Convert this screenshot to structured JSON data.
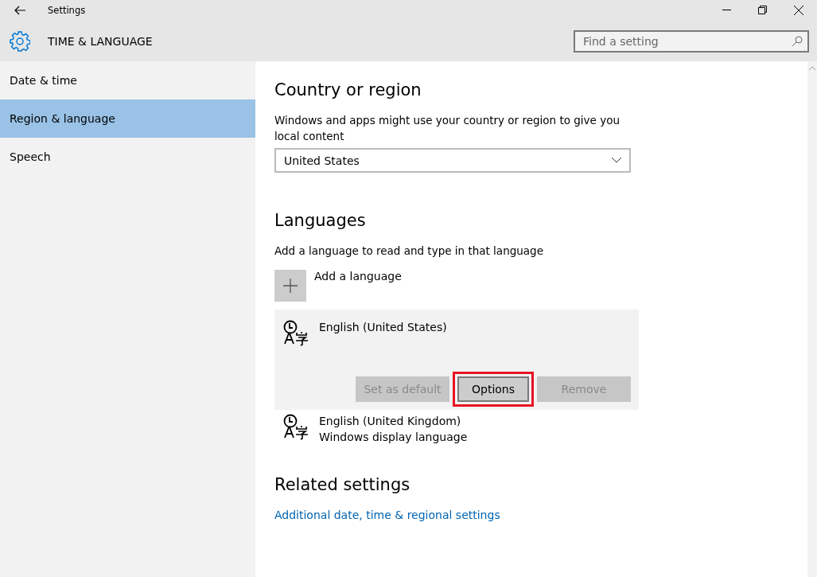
{
  "window": {
    "title": "Settings"
  },
  "header": {
    "title": "TIME & LANGUAGE",
    "search": {
      "placeholder": "Find a setting"
    }
  },
  "sidebar": {
    "items": [
      {
        "label": "Date & time",
        "selected": false
      },
      {
        "label": "Region & language",
        "selected": true
      },
      {
        "label": "Speech",
        "selected": false
      }
    ]
  },
  "country": {
    "heading": "Country or region",
    "description": "Windows and apps might use your country or region to give you local content",
    "value": "United States"
  },
  "languages": {
    "heading": "Languages",
    "description": "Add a language to read and type in that language",
    "add_label": "Add a language",
    "items": [
      {
        "name": "English (United States)",
        "selected": true,
        "buttons": [
          {
            "label": "Set as default",
            "disabled": true,
            "highlighted": false
          },
          {
            "label": "Options",
            "disabled": false,
            "highlighted": true
          },
          {
            "label": "Remove",
            "disabled": true,
            "highlighted": false
          }
        ]
      },
      {
        "name": "English (United Kingdom)",
        "subtitle": "Windows display language",
        "selected": false
      }
    ]
  },
  "related": {
    "heading": "Related settings",
    "link": "Additional date, time & regional settings"
  }
}
